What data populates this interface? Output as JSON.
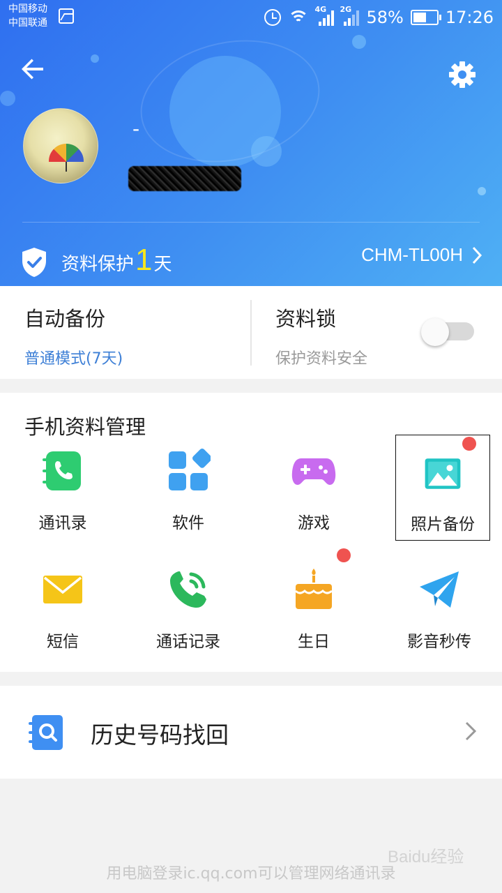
{
  "status_bar": {
    "carrier_1": "中国移动",
    "carrier_2": "中国联通",
    "net_1": "4G",
    "net_2": "2G",
    "battery": "58%",
    "battery_level": 0.58,
    "time": "17:26"
  },
  "header": {
    "nickname": "-",
    "protect_prefix": "资料保护",
    "protect_days": "1",
    "protect_suffix": "天",
    "device_name": "CHM-TL00H",
    "gradient_colors": [
      "#2f6ff0",
      "#4fb0f4"
    ]
  },
  "backup": {
    "auto_title": "自动备份",
    "auto_mode": "普通模式(7天)",
    "lock_title": "资料锁",
    "lock_desc": "保护资料安全",
    "lock_enabled": false,
    "mode_color": "#3d7fd6"
  },
  "manage": {
    "title": "手机资料管理",
    "items": [
      {
        "label": "通讯录",
        "icon": "contacts-icon"
      },
      {
        "label": "软件",
        "icon": "apps-icon"
      },
      {
        "label": "游戏",
        "icon": "gamepad-icon"
      },
      {
        "label": "照片备份",
        "icon": "photo-icon",
        "badge": true,
        "highlighted": true
      },
      {
        "label": "短信",
        "icon": "envelope-icon"
      },
      {
        "label": "通话记录",
        "icon": "phone-call-icon"
      },
      {
        "label": "生日",
        "icon": "birthday-cake-icon",
        "badge": true
      },
      {
        "label": "影音秒传",
        "icon": "paper-plane-icon"
      }
    ]
  },
  "history": {
    "label": "历史号码找回",
    "icon": "contact-search-icon"
  },
  "footer": {
    "text": "用电脑登录ic.qq.com可以管理网络通讯录"
  },
  "watermark": {
    "text": "Baidu经验"
  }
}
